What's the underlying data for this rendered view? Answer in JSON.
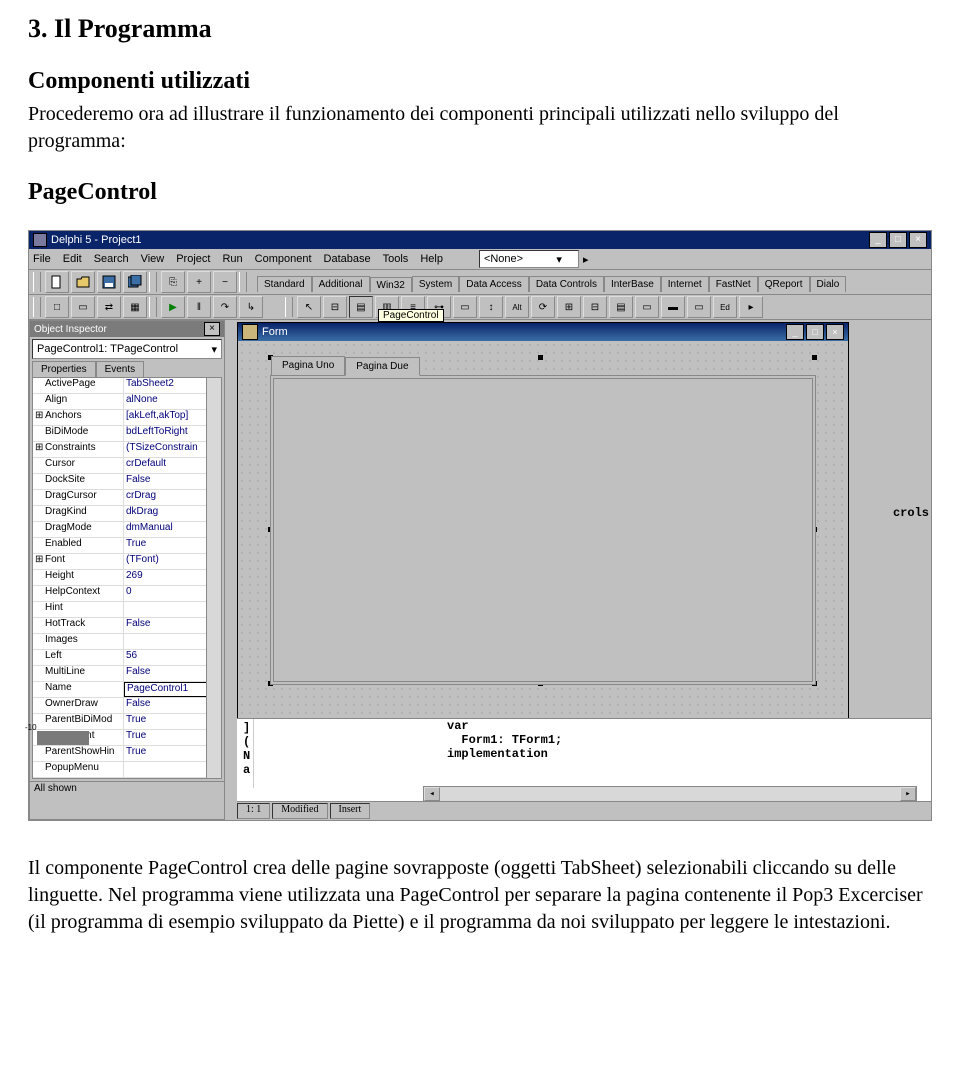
{
  "doc": {
    "heading": "3. Il Programma",
    "subheading": "Componenti utilizzati",
    "intro": "Procederemo ora ad illustrare il funzionamento dei componenti principali utilizzati nello sviluppo del programma:",
    "component_name": "PageControl",
    "outro": "Il componente PageControl crea delle pagine sovrapposte (oggetti TabSheet) selezionabili cliccando su delle linguette. Nel programma viene utilizzata una PageControl per separare la pagina contenente il Pop3 Excerciser (il programma di esempio sviluppato da Piette) e il programma da noi sviluppato per leggere le intestazioni."
  },
  "ide": {
    "title": "Delphi 5 - Project1",
    "menu": [
      "File",
      "Edit",
      "Search",
      "View",
      "Project",
      "Run",
      "Component",
      "Database",
      "Tools",
      "Help"
    ],
    "combo_text": "<None>",
    "comp_tabs": [
      "Standard",
      "Additional",
      "Win32",
      "System",
      "Data Access",
      "Data Controls",
      "InterBase",
      "Internet",
      "FastNet",
      "QReport",
      "Dialo"
    ],
    "active_comp_tab": "Win32",
    "tooltip": "PageControl"
  },
  "oi": {
    "title": "Object Inspector",
    "combo": "PageControl1: TPageControl",
    "tabs": [
      "Properties",
      "Events"
    ],
    "props": [
      {
        "k": "ActivePage",
        "v": "TabSheet2"
      },
      {
        "k": "Align",
        "v": "alNone"
      },
      {
        "k": "Anchors",
        "v": "[akLeft,akTop]",
        "exp": true
      },
      {
        "k": "BiDiMode",
        "v": "bdLeftToRight"
      },
      {
        "k": "Constraints",
        "v": "(TSizeConstrain",
        "exp": true
      },
      {
        "k": "Cursor",
        "v": "crDefault"
      },
      {
        "k": "DockSite",
        "v": "False"
      },
      {
        "k": "DragCursor",
        "v": "crDrag"
      },
      {
        "k": "DragKind",
        "v": "dkDrag"
      },
      {
        "k": "DragMode",
        "v": "dmManual"
      },
      {
        "k": "Enabled",
        "v": "True"
      },
      {
        "k": "Font",
        "v": "(TFont)",
        "exp": true
      },
      {
        "k": "Height",
        "v": "269"
      },
      {
        "k": "HelpContext",
        "v": "0"
      },
      {
        "k": "Hint",
        "v": ""
      },
      {
        "k": "HotTrack",
        "v": "False"
      },
      {
        "k": "Images",
        "v": ""
      },
      {
        "k": "Left",
        "v": "56"
      },
      {
        "k": "MultiLine",
        "v": "False"
      },
      {
        "k": "Name",
        "v": "PageControl1",
        "sel": true
      },
      {
        "k": "OwnerDraw",
        "v": "False"
      },
      {
        "k": "ParentBiDiMod",
        "v": "True"
      },
      {
        "k": "ParentFont",
        "v": "True"
      },
      {
        "k": "ParentShowHin",
        "v": "True"
      },
      {
        "k": "PopupMenu",
        "v": ""
      }
    ],
    "footer": "All shown"
  },
  "form": {
    "title": "Form",
    "tabs": [
      "Pagina Uno",
      "Pagina Due"
    ],
    "active_tab": "Pagina Due"
  },
  "code": {
    "lines": [
      "var",
      "  Form1: TForm1;",
      "",
      "implementation"
    ],
    "status_pos": "1: 1",
    "status_mod": "Modified",
    "status_ins": "Insert",
    "crols": "crols",
    "peek": [
      "]",
      "(",
      "N",
      "a"
    ]
  },
  "side_label": "-10"
}
